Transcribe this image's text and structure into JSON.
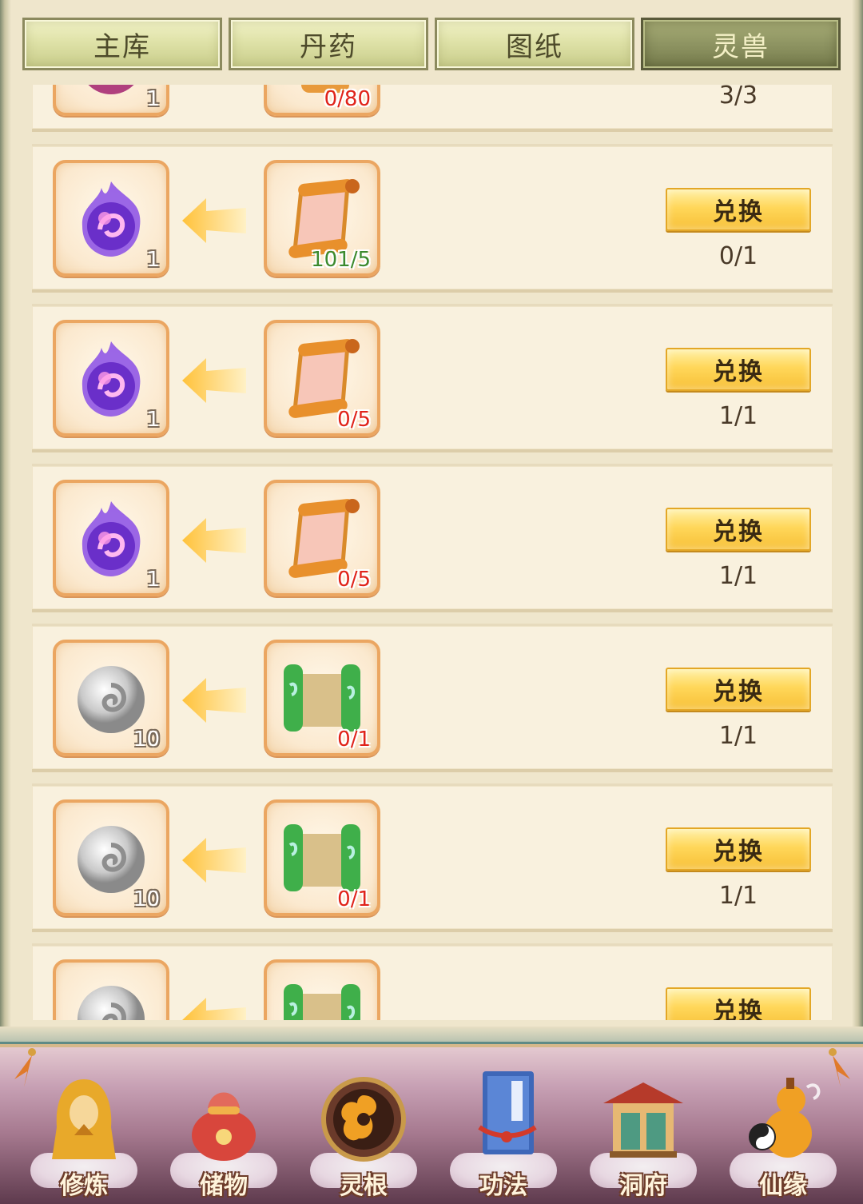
{
  "tabs": [
    {
      "label": "主库",
      "active": false
    },
    {
      "label": "丹药",
      "active": false
    },
    {
      "label": "图纸",
      "active": false
    },
    {
      "label": "灵兽",
      "active": true
    }
  ],
  "exchange_rows": [
    {
      "reward_icon": "pink-orb-icon",
      "reward_count": "1",
      "cost_icon": "scroll-icon",
      "cost_count": "0/80",
      "cost_color": "red",
      "button_label": "",
      "limit": "3/3",
      "partial": "top"
    },
    {
      "reward_icon": "purple-flame-orb-icon",
      "reward_count": "1",
      "cost_icon": "pink-scroll-icon",
      "cost_count": "101/5",
      "cost_color": "green",
      "button_label": "兑换",
      "limit": "0/1"
    },
    {
      "reward_icon": "purple-flame-orb-icon",
      "reward_count": "1",
      "cost_icon": "pink-scroll-icon",
      "cost_count": "0/5",
      "cost_color": "red",
      "button_label": "兑换",
      "limit": "1/1"
    },
    {
      "reward_icon": "purple-flame-orb-icon",
      "reward_count": "1",
      "cost_icon": "pink-scroll-icon",
      "cost_count": "0/5",
      "cost_color": "red",
      "button_label": "兑换",
      "limit": "1/1"
    },
    {
      "reward_icon": "silver-swirl-coin-icon",
      "reward_count": "10",
      "cost_icon": "green-scroll-icon",
      "cost_count": "0/1",
      "cost_color": "red",
      "button_label": "兑换",
      "limit": "1/1"
    },
    {
      "reward_icon": "silver-swirl-coin-icon",
      "reward_count": "10",
      "cost_icon": "green-scroll-icon",
      "cost_count": "0/1",
      "cost_color": "red",
      "button_label": "兑换",
      "limit": "1/1"
    },
    {
      "reward_icon": "silver-swirl-coin-icon",
      "reward_count": "",
      "cost_icon": "green-scroll-icon",
      "cost_count": "",
      "cost_color": "red",
      "button_label": "兑换",
      "limit": "",
      "partial": "bottom"
    }
  ],
  "bottom_nav": [
    {
      "label": "修炼",
      "icon": "hooded-cultivator-icon"
    },
    {
      "label": "储物",
      "icon": "storage-bag-icon"
    },
    {
      "label": "灵根",
      "icon": "spirit-root-triskelion-icon"
    },
    {
      "label": "功法",
      "icon": "technique-book-icon"
    },
    {
      "label": "洞府",
      "icon": "cave-palace-icon"
    },
    {
      "label": "仙缘",
      "icon": "gourd-yinyang-icon"
    }
  ],
  "colors": {
    "accent_gold": "#ffd75a",
    "slot_border": "#eba661",
    "count_red": "#e0231a",
    "count_green": "#3c8a2e"
  }
}
